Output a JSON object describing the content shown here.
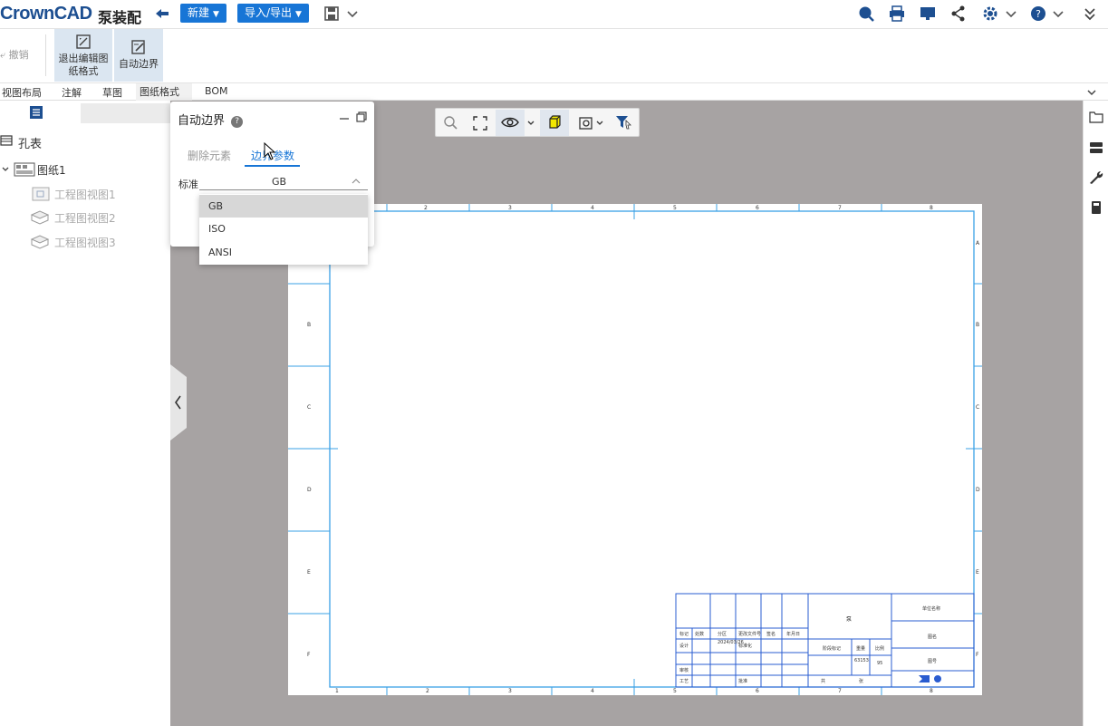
{
  "topbar": {
    "logo_text": "CrownCAD",
    "doc_title": "泵装配",
    "new_label": "新建",
    "import_export_label": "导入/导出"
  },
  "ribbon": {
    "undo_label": "撤销",
    "exit_edit_line1": "退出编辑图",
    "exit_edit_line2": "纸格式",
    "auto_border_label": "自动边界"
  },
  "tabs": [
    "视图布局",
    "注解",
    "草图",
    "图纸格式",
    "BOM"
  ],
  "left_panel": {
    "hole_table_label": "孔表",
    "sheet_label": "图纸1",
    "views": [
      "工程图视图1",
      "工程图视图2",
      "工程图视图3"
    ]
  },
  "panel": {
    "title": "自动边界",
    "tab_delete": "删除元素",
    "tab_params": "边界参数",
    "std_label": "标准",
    "std_value": "GB",
    "options": [
      "GB",
      "ISO",
      "ANSI"
    ]
  },
  "drawing": {
    "top_numbers": [
      "2",
      "3",
      "4",
      "5",
      "6",
      "7",
      "8"
    ],
    "bottom_numbers": [
      "1",
      "2",
      "3",
      "4",
      "5",
      "6",
      "7",
      "8"
    ],
    "left_letters": [
      "B",
      "C",
      "D",
      "E",
      "F"
    ],
    "right_letters": [
      "A",
      "B",
      "C",
      "D",
      "E",
      "F"
    ],
    "title_block": {
      "c1": "标记",
      "c2": "处数",
      "c3": "分区",
      "c4": "更改文件号",
      "c5": "签名",
      "c6": "年月日",
      "design": "设计",
      "date": "2024/03/26",
      "std": "标准化",
      "review": "审核",
      "craft": "工艺",
      "approve": "批准",
      "stage": "阶段标记",
      "weight": "重量",
      "scale": "比例",
      "weight_val": "63153",
      "scale_val": "95",
      "total": "共",
      "page": "张",
      "name": "泵",
      "company": "单位名称",
      "drawing_name": "图名",
      "code": "图号"
    }
  }
}
